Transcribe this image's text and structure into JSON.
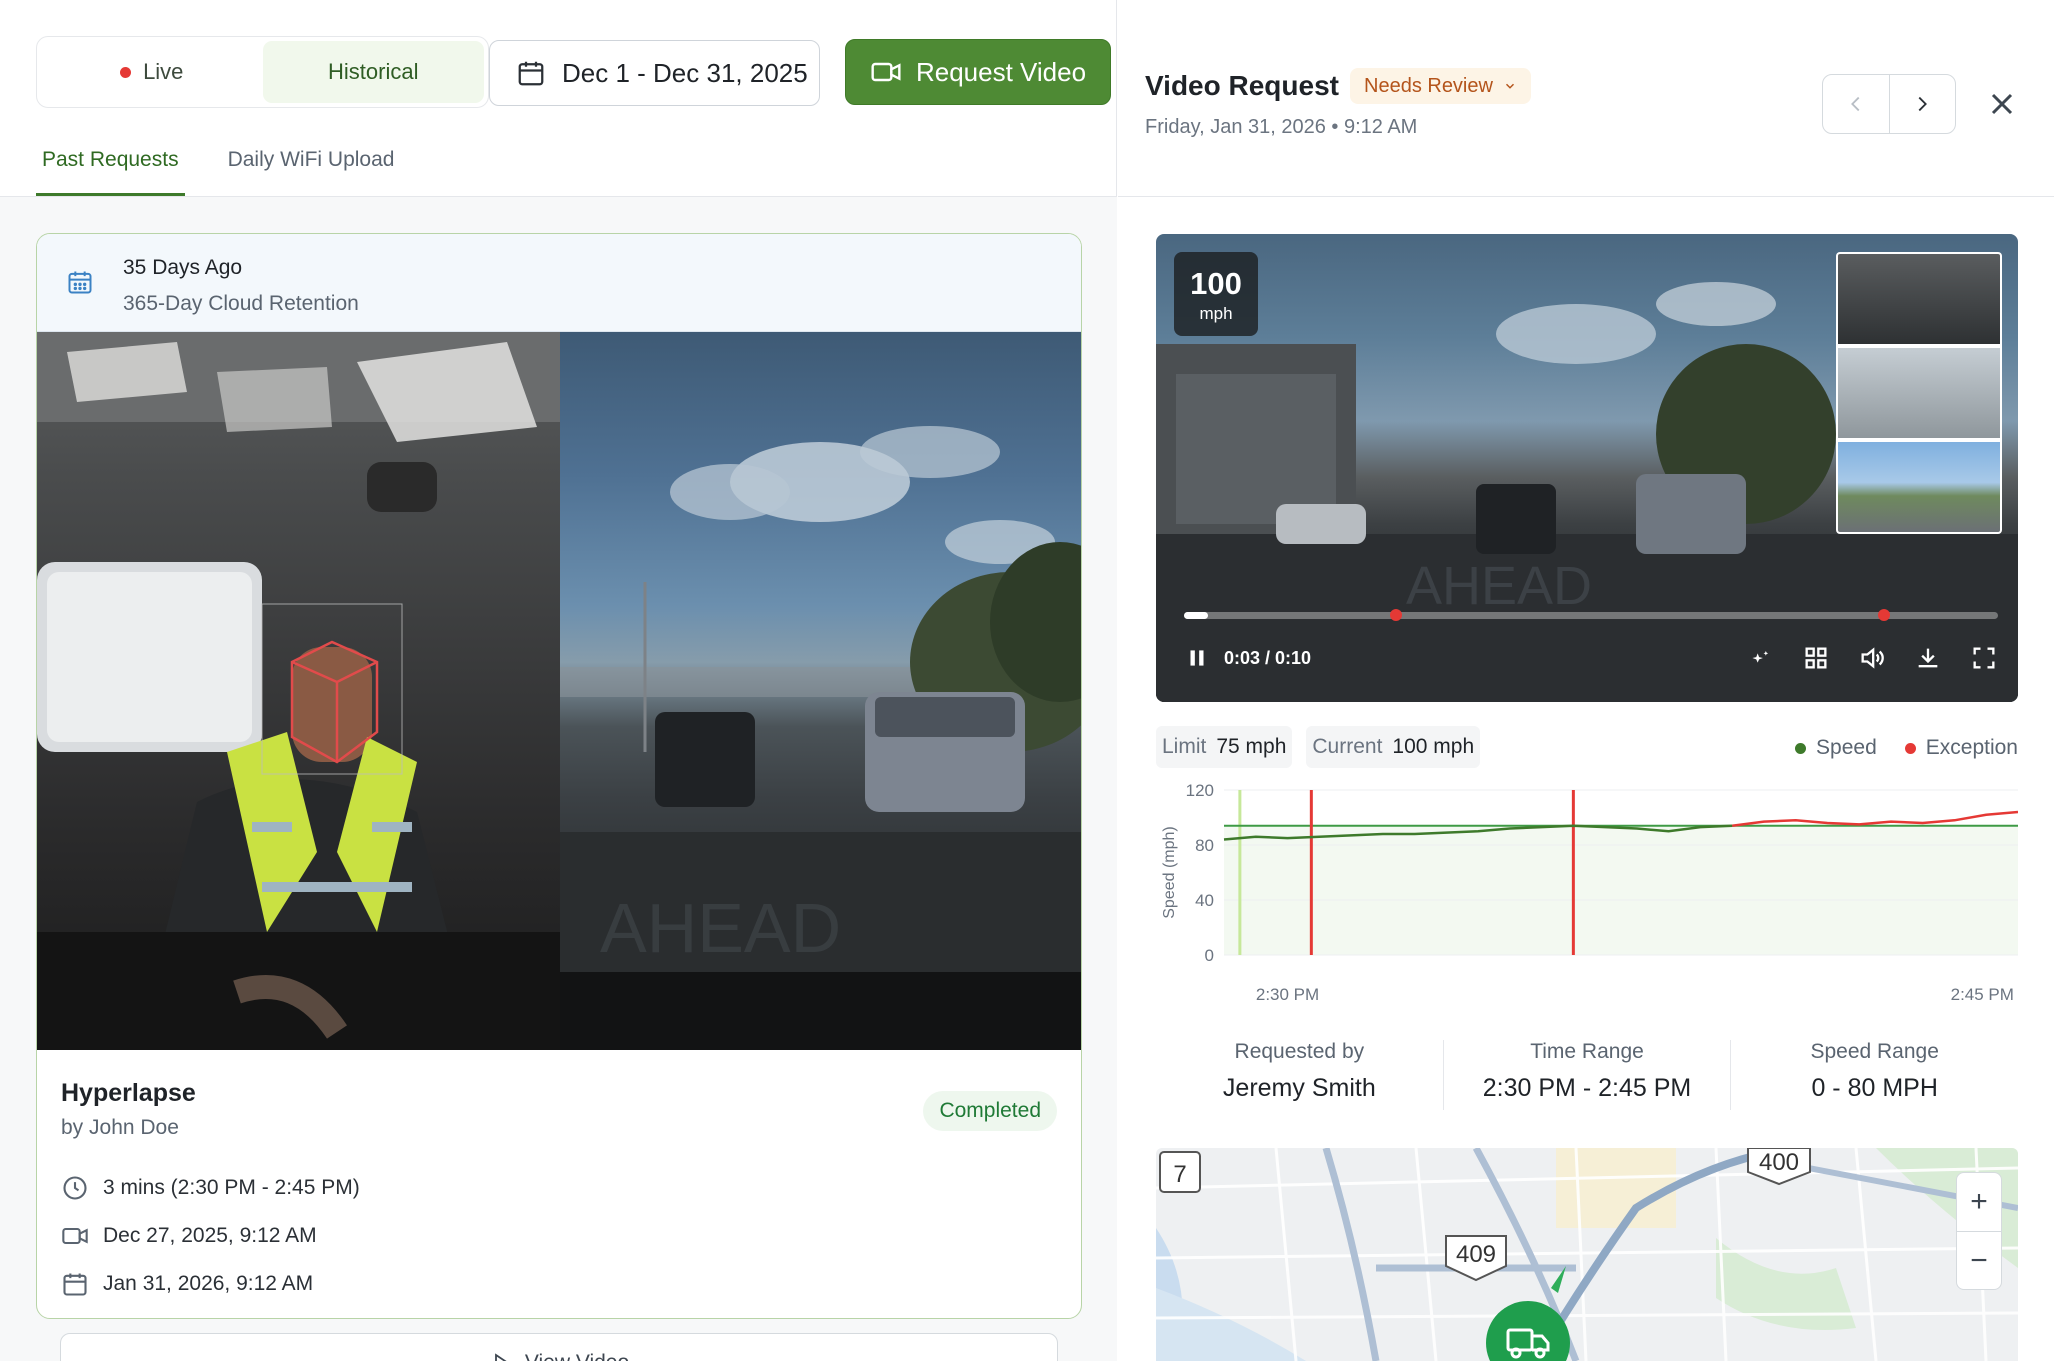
{
  "left": {
    "toggle": {
      "live": "Live",
      "historical": "Historical"
    },
    "date_range": "Dec 1 - Dec 31, 2025",
    "request_video": "Request Video",
    "tabs": [
      {
        "label": "Past Requests"
      },
      {
        "label": "Daily WiFi Upload"
      }
    ],
    "card": {
      "retention_title": "35 Days Ago",
      "retention_sub": "365-Day Cloud Retention",
      "title": "Hyperlapse",
      "author": "by John Doe",
      "status": "Completed",
      "duration": "3 mins (2:30 PM - 2:45 PM)",
      "recorded": "Dec 27, 2025, 9:12 AM",
      "requested": "Jan 31, 2026, 9:12 AM"
    },
    "view_video": "View Video"
  },
  "right": {
    "title": "Video Request",
    "status": "Needs Review",
    "datetime": "Friday, Jan 31, 2026 • 9:12 AM",
    "player": {
      "speed_value": "100",
      "speed_unit": "mph",
      "time": "0:03 / 0:10",
      "progress": 0.03,
      "events": [
        0.26,
        0.86
      ]
    },
    "chips": {
      "limit_label": "Limit",
      "limit_value": "75 mph",
      "current_label": "Current",
      "current_value": "100 mph"
    },
    "legend": {
      "speed": "Speed",
      "exception": "Exception"
    },
    "stats": {
      "requested_by_label": "Requested by",
      "requested_by": "Jeremy Smith",
      "time_range_label": "Time Range",
      "time_range": "2:30 PM - 2:45 PM",
      "speed_range_label": "Speed Range",
      "speed_range": "0 - 80 MPH"
    },
    "map": {
      "shields": [
        "7",
        "409",
        "400"
      ],
      "zoom_in": "+",
      "zoom_out": "−"
    }
  },
  "colors": {
    "brand_green": "#4e8a34",
    "exception_red": "#e53935",
    "speed_green": "#3e7a2b",
    "warning": "#b4541b"
  },
  "chart_data": {
    "type": "line",
    "ylabel": "Speed (mph)",
    "ylim": [
      0,
      120
    ],
    "yticks": [
      0,
      40,
      80,
      120
    ],
    "xticks": [
      "2:30 PM",
      "2:45 PM"
    ],
    "limit_line": 94,
    "exceptions": [
      0.11,
      0.44
    ],
    "series": [
      {
        "name": "Speed",
        "color": "#3e7a2b",
        "x": [
          0.0,
          0.04,
          0.08,
          0.12,
          0.16,
          0.2,
          0.24,
          0.28,
          0.32,
          0.36,
          0.4,
          0.44,
          0.48,
          0.52,
          0.56,
          0.6,
          0.64
        ],
        "y": [
          84,
          86,
          85,
          86,
          87,
          88,
          88,
          89,
          90,
          92,
          93,
          94,
          93,
          92,
          90,
          93,
          94
        ]
      },
      {
        "name": "Exception",
        "color": "#e53935",
        "x": [
          0.64,
          0.68,
          0.72,
          0.76,
          0.8,
          0.84,
          0.88,
          0.92,
          0.96,
          1.0
        ],
        "y": [
          94,
          97,
          98,
          96,
          95,
          97,
          96,
          98,
          102,
          104
        ]
      }
    ]
  }
}
